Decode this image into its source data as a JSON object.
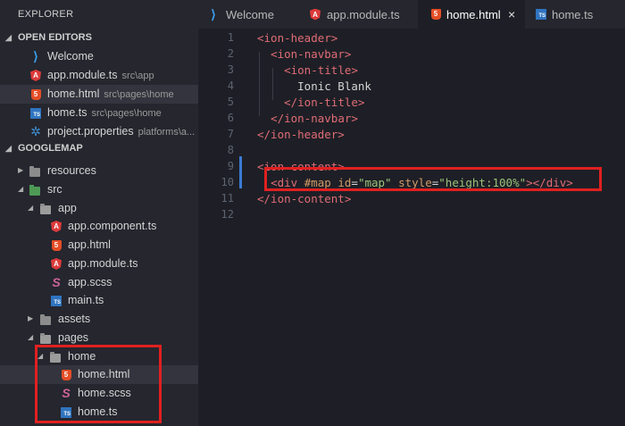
{
  "sidebar": {
    "title": "EXPLORER",
    "open_editors": {
      "label": "OPEN EDITORS",
      "items": [
        {
          "name": "Welcome",
          "path": "",
          "icon": "vscode-icon"
        },
        {
          "name": "app.module.ts",
          "path": "src\\app",
          "icon": "angular-icon"
        },
        {
          "name": "home.html",
          "path": "src\\pages\\home",
          "icon": "html5-icon"
        },
        {
          "name": "home.ts",
          "path": "src\\pages\\home",
          "icon": "typescript-icon"
        },
        {
          "name": "project.properties",
          "path": "platforms\\a...",
          "icon": "gear-icon"
        }
      ]
    },
    "project": {
      "label": "GOOGLEMAP",
      "tree": [
        {
          "name": "resources",
          "icon": "folder-icon",
          "arrow": "▶"
        },
        {
          "name": "src",
          "icon": "src-folder-icon",
          "arrow": "◢"
        },
        {
          "name": "app",
          "icon": "folder-open-icon",
          "arrow": "◢"
        },
        {
          "name": "app.component.ts",
          "icon": "angular-icon"
        },
        {
          "name": "app.html",
          "icon": "html5-icon"
        },
        {
          "name": "app.module.ts",
          "icon": "angular-icon"
        },
        {
          "name": "app.scss",
          "icon": "sass-icon"
        },
        {
          "name": "main.ts",
          "icon": "typescript-icon"
        },
        {
          "name": "assets",
          "icon": "folder-icon",
          "arrow": "▶"
        },
        {
          "name": "pages",
          "icon": "folder-open-icon",
          "arrow": "◢"
        },
        {
          "name": "home",
          "icon": "folder-open-icon",
          "arrow": "◢"
        },
        {
          "name": "home.html",
          "icon": "html5-icon"
        },
        {
          "name": "home.scss",
          "icon": "sass-icon"
        },
        {
          "name": "home.ts",
          "icon": "typescript-icon"
        }
      ]
    }
  },
  "tabs": [
    {
      "label": "Welcome",
      "icon": "vscode-icon"
    },
    {
      "label": "app.module.ts",
      "icon": "angular-icon"
    },
    {
      "label": "home.html",
      "icon": "html5-icon",
      "close": "×"
    },
    {
      "label": "home.ts",
      "icon": "typescript-icon"
    }
  ],
  "editor": {
    "line_numbers": [
      "1",
      "2",
      "3",
      "4",
      "5",
      "6",
      "7",
      "8",
      "9",
      "10",
      "11",
      "12"
    ],
    "lines": [
      [
        {
          "t": "tag",
          "v": "<ion-header>"
        }
      ],
      [
        {
          "t": "txt",
          "v": "  "
        },
        {
          "t": "tag",
          "v": "<ion-navbar>"
        }
      ],
      [
        {
          "t": "txt",
          "v": "    "
        },
        {
          "t": "tag",
          "v": "<ion-title>"
        }
      ],
      [
        {
          "t": "txt",
          "v": "      Ionic Blank"
        }
      ],
      [
        {
          "t": "txt",
          "v": "    "
        },
        {
          "t": "tag",
          "v": "</ion-title>"
        }
      ],
      [
        {
          "t": "txt",
          "v": "  "
        },
        {
          "t": "tag",
          "v": "</ion-navbar>"
        }
      ],
      [
        {
          "t": "tag",
          "v": "</ion-header>"
        }
      ],
      [],
      [
        {
          "t": "tag",
          "v": "<ion-content>"
        }
      ],
      [
        {
          "t": "txt",
          "v": "  "
        },
        {
          "t": "tag",
          "v": "<div "
        },
        {
          "t": "attr",
          "v": "#map "
        },
        {
          "t": "attr",
          "v": "id"
        },
        {
          "t": "txt",
          "v": "="
        },
        {
          "t": "str",
          "v": "\"map\""
        },
        {
          "t": "txt",
          "v": " "
        },
        {
          "t": "attr",
          "v": "style"
        },
        {
          "t": "txt",
          "v": "="
        },
        {
          "t": "str",
          "v": "\"height:100%\""
        },
        {
          "t": "tag",
          "v": "></div>"
        }
      ],
      [
        {
          "t": "tag",
          "v": "</ion-content>"
        }
      ],
      []
    ]
  },
  "colors": {
    "highlight_box": "#e02020",
    "sidebar_bg": "#25262e",
    "editor_bg": "#1e1f26",
    "tag": "#e06c75",
    "attr": "#d19a66",
    "string": "#98c379"
  }
}
